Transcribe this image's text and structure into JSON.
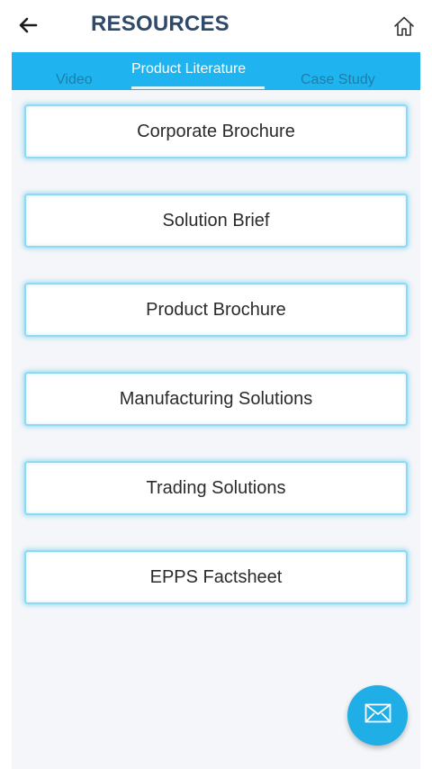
{
  "header": {
    "title": "RESOURCES",
    "back_icon": "arrow-left-icon",
    "home_icon": "home-icon"
  },
  "tabs": [
    {
      "label": "Video",
      "active": false
    },
    {
      "label": "Product Literature",
      "active": true
    },
    {
      "label": "Case Study",
      "active": false
    }
  ],
  "items": [
    {
      "label": "Corporate Brochure"
    },
    {
      "label": "Solution Brief"
    },
    {
      "label": "Product Brochure"
    },
    {
      "label": "Manufacturing Solutions"
    },
    {
      "label": "Trading Solutions"
    },
    {
      "label": "EPPS Factsheet"
    }
  ],
  "fab": {
    "icon": "mail-icon"
  },
  "colors": {
    "accent": "#1fb4ef",
    "title": "#2e4a6b",
    "item_border": "#8fd9f3",
    "fab": "#1faee6"
  }
}
